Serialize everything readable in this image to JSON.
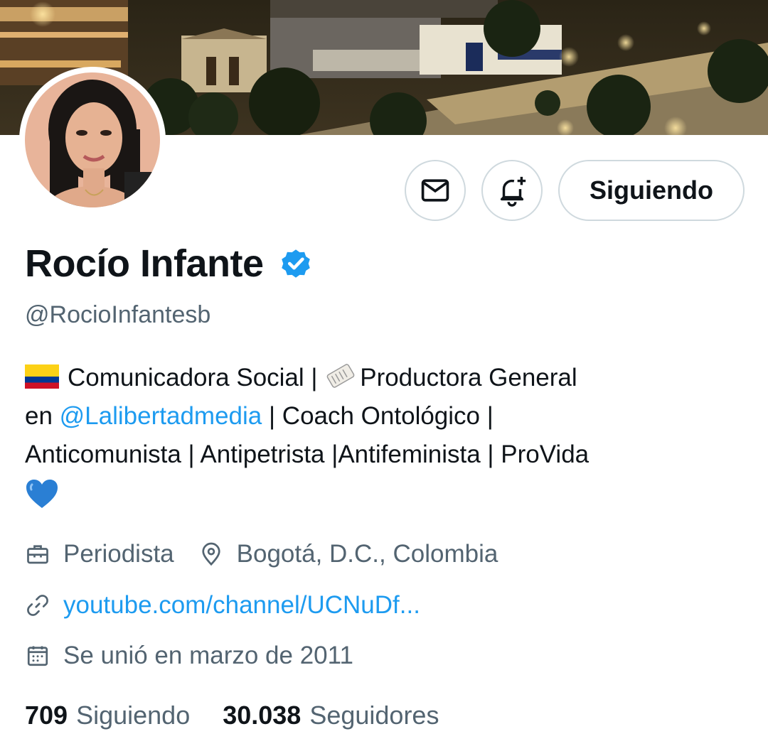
{
  "profile": {
    "name": "Rocío Infante",
    "handle": "@RocioInfantesb",
    "verified": true,
    "follow_button_label": "Siguiendo",
    "bio": {
      "line1_text": "Comunicadora Social | ",
      "line1_rest": "Productora General",
      "line2_prefix": "en ",
      "line2_mention": "@Lalibertadmedia",
      "line2_rest": " | Coach Ontológico |",
      "line3": "Anticomunista | Antipetrista |Antifeminista | ProVida"
    },
    "occupation": "Periodista",
    "location": "Bogotá, D.C., Colombia",
    "website": "youtube.com/channel/UCNuDf...",
    "joined": "Se unió en marzo de 2011",
    "following_count": "709",
    "following_label": "Siguiendo",
    "followers_count": "30.038",
    "followers_label": "Seguidores"
  },
  "icons": {
    "message": "envelope-icon",
    "notify": "bell-plus-icon",
    "verified": "verified-badge-icon",
    "occupation": "briefcase-icon",
    "location": "map-pin-icon",
    "website": "link-icon",
    "joined": "calendar-icon"
  },
  "colors": {
    "accent": "#1d9bf0",
    "secondary_text": "#536471",
    "primary_text": "#0f1419",
    "border": "#cfd9de"
  }
}
